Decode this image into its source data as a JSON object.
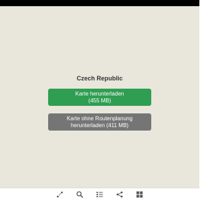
{
  "map": {
    "country_name": "Czech Republic",
    "download_button": {
      "line1": "Karte herunterladen",
      "line2": "(455 MB)"
    },
    "download_no_routing_button": {
      "line1": "Karte ohne Routenplanung",
      "line2": "herunterladen (411 MB)"
    }
  },
  "bottom_nav": {
    "icons": [
      "route-icon",
      "search-icon",
      "bookmarks-list-icon",
      "share-icon",
      "menu-grid-icon"
    ]
  },
  "colors": {
    "map_background": "#e9e6dc",
    "download_green": "#2f9e52",
    "download_gray": "#757575",
    "icon_color": "#555555"
  }
}
